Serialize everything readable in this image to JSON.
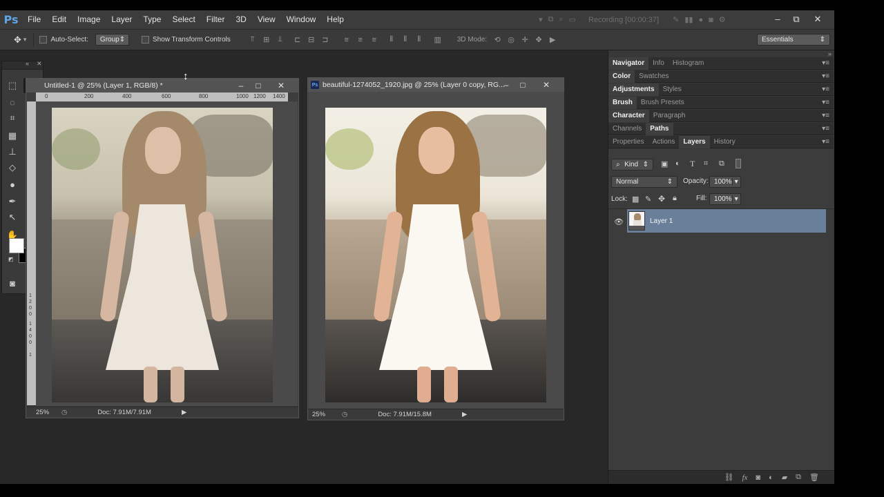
{
  "menubar": {
    "logo": "Ps",
    "items": [
      "File",
      "Edit",
      "Image",
      "Layer",
      "Type",
      "Select",
      "Filter",
      "3D",
      "View",
      "Window",
      "Help"
    ],
    "recording": "Recording [00:00:37]",
    "minimize": "–",
    "restore": "⧉",
    "close": "✕"
  },
  "options": {
    "auto_select_label": "Auto-Select:",
    "auto_select_value": "Group",
    "show_transform_label": "Show Transform Controls",
    "mode_3d_label": "3D Mode:",
    "workspace": "Essentials"
  },
  "tools": {
    "fg_color": "#ffffff",
    "bg_color": "#000000"
  },
  "doc1": {
    "title": "Untitled-1 @ 25% (Layer 1, RGB/8) *",
    "zoom": "25%",
    "doc_size": "Doc: 7.91M/7.91M",
    "ruler_marks": [
      "0",
      "200",
      "400",
      "600",
      "800",
      "1000",
      "1200",
      "1400"
    ],
    "ruler_v_marks": [
      "1",
      "2",
      "0",
      "0",
      "1",
      "4",
      "0",
      "0",
      "1"
    ]
  },
  "doc2": {
    "title": "beautiful-1274052_1920.jpg @ 25% (Layer 0 copy, RG...",
    "zoom": "25%",
    "doc_size": "Doc: 7.91M/15.8M"
  },
  "panels": {
    "row1": [
      "Navigator",
      "Info",
      "Histogram"
    ],
    "row2": [
      "Color",
      "Swatches"
    ],
    "row3": [
      "Adjustments",
      "Styles"
    ],
    "row4": [
      "Brush",
      "Brush Presets"
    ],
    "row5": [
      "Character",
      "Paragraph"
    ],
    "row6": [
      "Channels",
      "Paths"
    ],
    "row7": [
      "Properties",
      "Actions",
      "Layers",
      "History"
    ],
    "menu_glyph": "▾≡",
    "layers": {
      "filter_kind": "Kind",
      "blend_mode": "Normal",
      "opacity_label": "Opacity:",
      "opacity_value": "100%",
      "lock_label": "Lock:",
      "fill_label": "Fill:",
      "fill_value": "100%",
      "layer_name": "Layer 1"
    }
  }
}
